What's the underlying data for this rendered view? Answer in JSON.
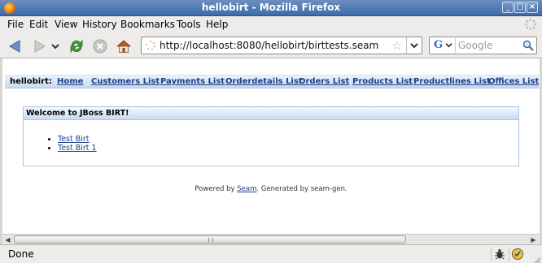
{
  "window": {
    "title": "hellobirt - Mozilla Firefox"
  },
  "menubar": {
    "items": [
      "File",
      "Edit",
      "View",
      "History",
      "Bookmarks",
      "Tools",
      "Help"
    ]
  },
  "toolbar": {
    "url": "http://localhost:8080/hellobirt/birttests.seam",
    "search_placeholder": "Google",
    "search_engine": "G"
  },
  "app_menu": {
    "brand": "hellobirt:",
    "links": [
      "Home",
      "Customers List",
      "Payments List",
      "Orderdetails List",
      "Orders List",
      "Products List",
      "Productlines List",
      "Offices List"
    ]
  },
  "panel": {
    "header": "Welcome to JBoss BIRT!",
    "links": [
      "Test Birt",
      "Test Birt 1"
    ]
  },
  "footer": {
    "prefix": "Powered by ",
    "link": "Seam",
    "suffix": ". Generated by seam-gen."
  },
  "status": {
    "text": "Done"
  },
  "colors": {
    "titlebar": "#3d6aa8",
    "link": "#1b3f87",
    "panel_border": "#a9c5e6"
  }
}
